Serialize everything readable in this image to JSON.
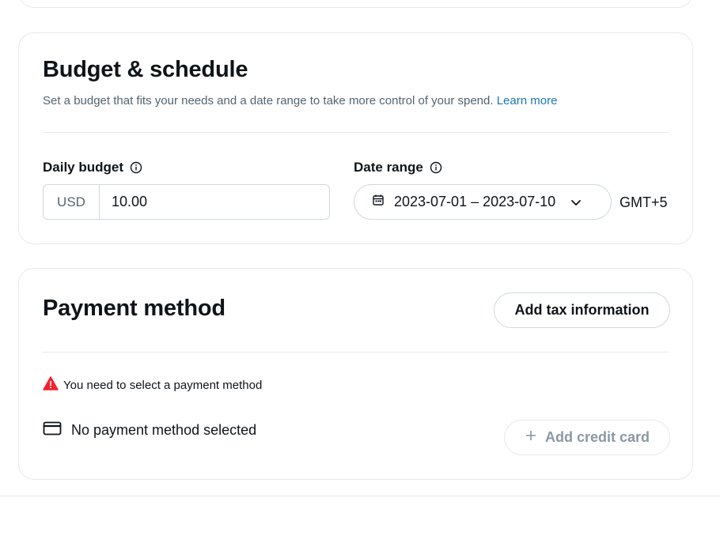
{
  "budget_section": {
    "title": "Budget & schedule",
    "subtitle": "Set a budget that fits your needs and a date range to take more control of your spend.",
    "learn_more": "Learn more",
    "daily_budget": {
      "label": "Daily budget",
      "currency": "USD",
      "value": "10.00"
    },
    "date_range": {
      "label": "Date range",
      "value": "2023-07-01 – 2023-07-10",
      "timezone": "GMT+5"
    }
  },
  "payment_section": {
    "title": "Payment method",
    "add_tax_label": "Add tax information",
    "warning": "You need to select a payment method",
    "no_payment": "No payment method selected",
    "add_card_label": "Add credit card"
  },
  "colors": {
    "link": "#1d77b8",
    "warning_red": "#f4212e",
    "border": "#cfd9de"
  },
  "icons": [
    "info-icon",
    "calendar-icon",
    "chevron-down-icon",
    "warning-icon",
    "credit-card-icon",
    "plus-icon"
  ]
}
